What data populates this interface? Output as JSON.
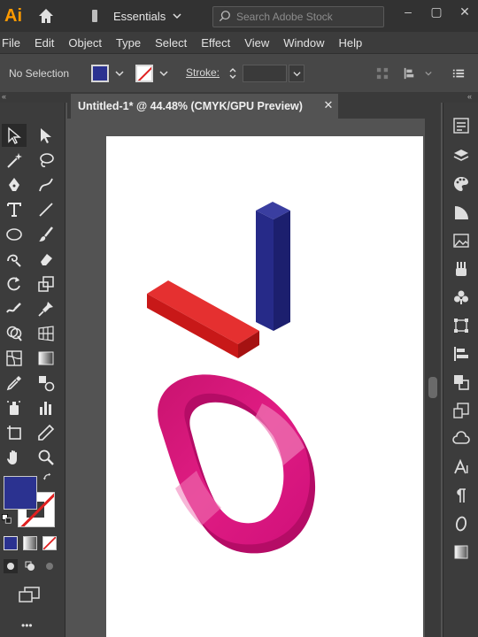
{
  "app": {
    "logo": "Ai",
    "workspace": "Essentials",
    "search_placeholder": "Search Adobe Stock"
  },
  "menu": [
    "File",
    "Edit",
    "Object",
    "Type",
    "Select",
    "Effect",
    "View",
    "Window",
    "Help"
  ],
  "control": {
    "selection_status": "No Selection",
    "stroke_label": "Stroke:",
    "fill_color": "#2b3290"
  },
  "document": {
    "tab_title": "Untitled-1* @ 44.48% (CMYK/GPU Preview)"
  },
  "artwork": {
    "red_bar_color": "#e21b1b",
    "blue_bar_color": "#2a2d8c",
    "ring_color": "#e0187e"
  },
  "icons": {
    "collapse_left": "«",
    "collapse_right": "«",
    "window_minimize": "–",
    "window_restore": "▢",
    "window_close": "✕",
    "tab_close": "✕",
    "more": "•••"
  }
}
